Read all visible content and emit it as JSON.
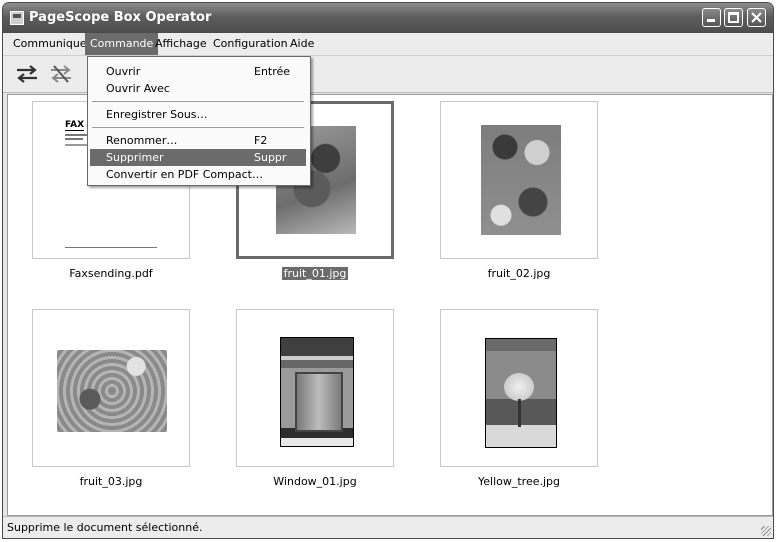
{
  "window": {
    "title": "PageScope Box Operator"
  },
  "menubar": {
    "items": [
      "Communiquer",
      "Commande",
      "Affichage",
      "Configuration",
      "Aide"
    ],
    "active": "Commande"
  },
  "toolbar": {
    "icons": [
      "swap-arrows-icon",
      "cancel-swap-icon"
    ]
  },
  "dropdown": {
    "items": [
      {
        "label": "Ouvrir",
        "shortcut": "Entrée"
      },
      {
        "label": "Ouvrir Avec",
        "shortcut": ""
      },
      {
        "label": "Enregistrer Sous…",
        "shortcut": ""
      },
      {
        "label": "Renommer…",
        "shortcut": "F2"
      },
      {
        "label": "Supprimer",
        "shortcut": "Suppr"
      },
      {
        "label": "Convertir en PDF Compact…",
        "shortcut": ""
      }
    ],
    "highlighted": "Supprimer"
  },
  "files": [
    {
      "name": "Faxsending.pdf",
      "selected": false,
      "thumb_label": "FAX"
    },
    {
      "name": "fruit_01.jpg",
      "selected": true
    },
    {
      "name": "fruit_02.jpg",
      "selected": false
    },
    {
      "name": "fruit_03.jpg",
      "selected": false
    },
    {
      "name": "Window_01.jpg",
      "selected": false
    },
    {
      "name": "Yellow_tree.jpg",
      "selected": false
    }
  ],
  "statusbar": {
    "text": "Supprime le document sélectionné."
  }
}
